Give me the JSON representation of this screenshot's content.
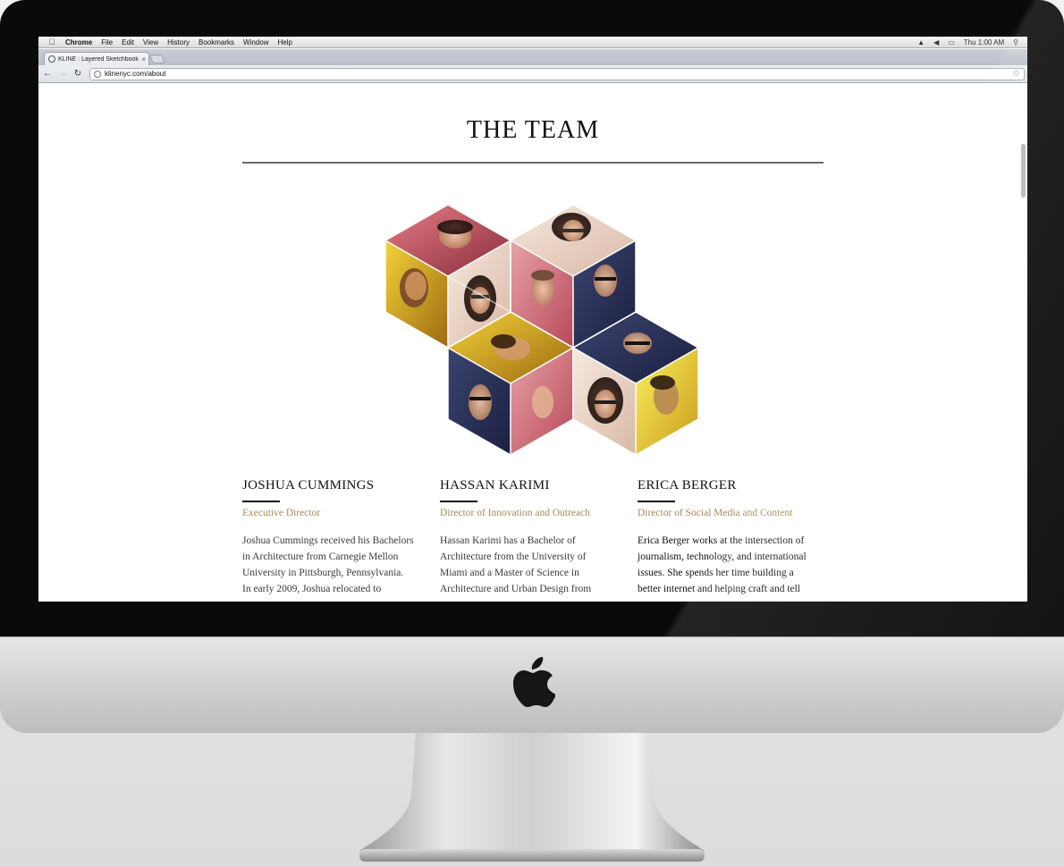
{
  "menubar": {
    "app": "Chrome",
    "items": [
      "File",
      "Edit",
      "View",
      "History",
      "Bookmarks",
      "Window",
      "Help"
    ],
    "clock": "Thu 1:00 AM"
  },
  "browser": {
    "tab_title": "KLINE : Layered Sketchbook",
    "url": "klinenyc.com/about"
  },
  "page": {
    "title": "THE TEAM",
    "members": [
      {
        "name": "JOSHUA CUMMINGS",
        "role": "Executive Director",
        "bio": [
          "Joshua Cummings received his Bachelors",
          "in Architecture from Carnegie Mellon",
          "University in Pittsburgh, Pennsylvania.",
          "In early 2009, Joshua relocated to"
        ]
      },
      {
        "name": "HASSAN KARIMI",
        "role": "Director of Innovation and Outreach",
        "bio": [
          "Hassan Karimi has a Bachelor of",
          "Architecture from the University of",
          "Miami and a Master of Science in",
          "Architecture and Urban Design from"
        ]
      },
      {
        "name": "ERICA BERGER",
        "role": "Director of Social Media and Content",
        "bio": [
          "Erica Berger works at the intersection of",
          "journalism, technology, and international",
          "issues.  She spends her time building a",
          "better internet and helping craft and tell"
        ]
      }
    ]
  },
  "colors": {
    "role_accent": "#a38a5c",
    "rule": "#6b6b6b"
  }
}
